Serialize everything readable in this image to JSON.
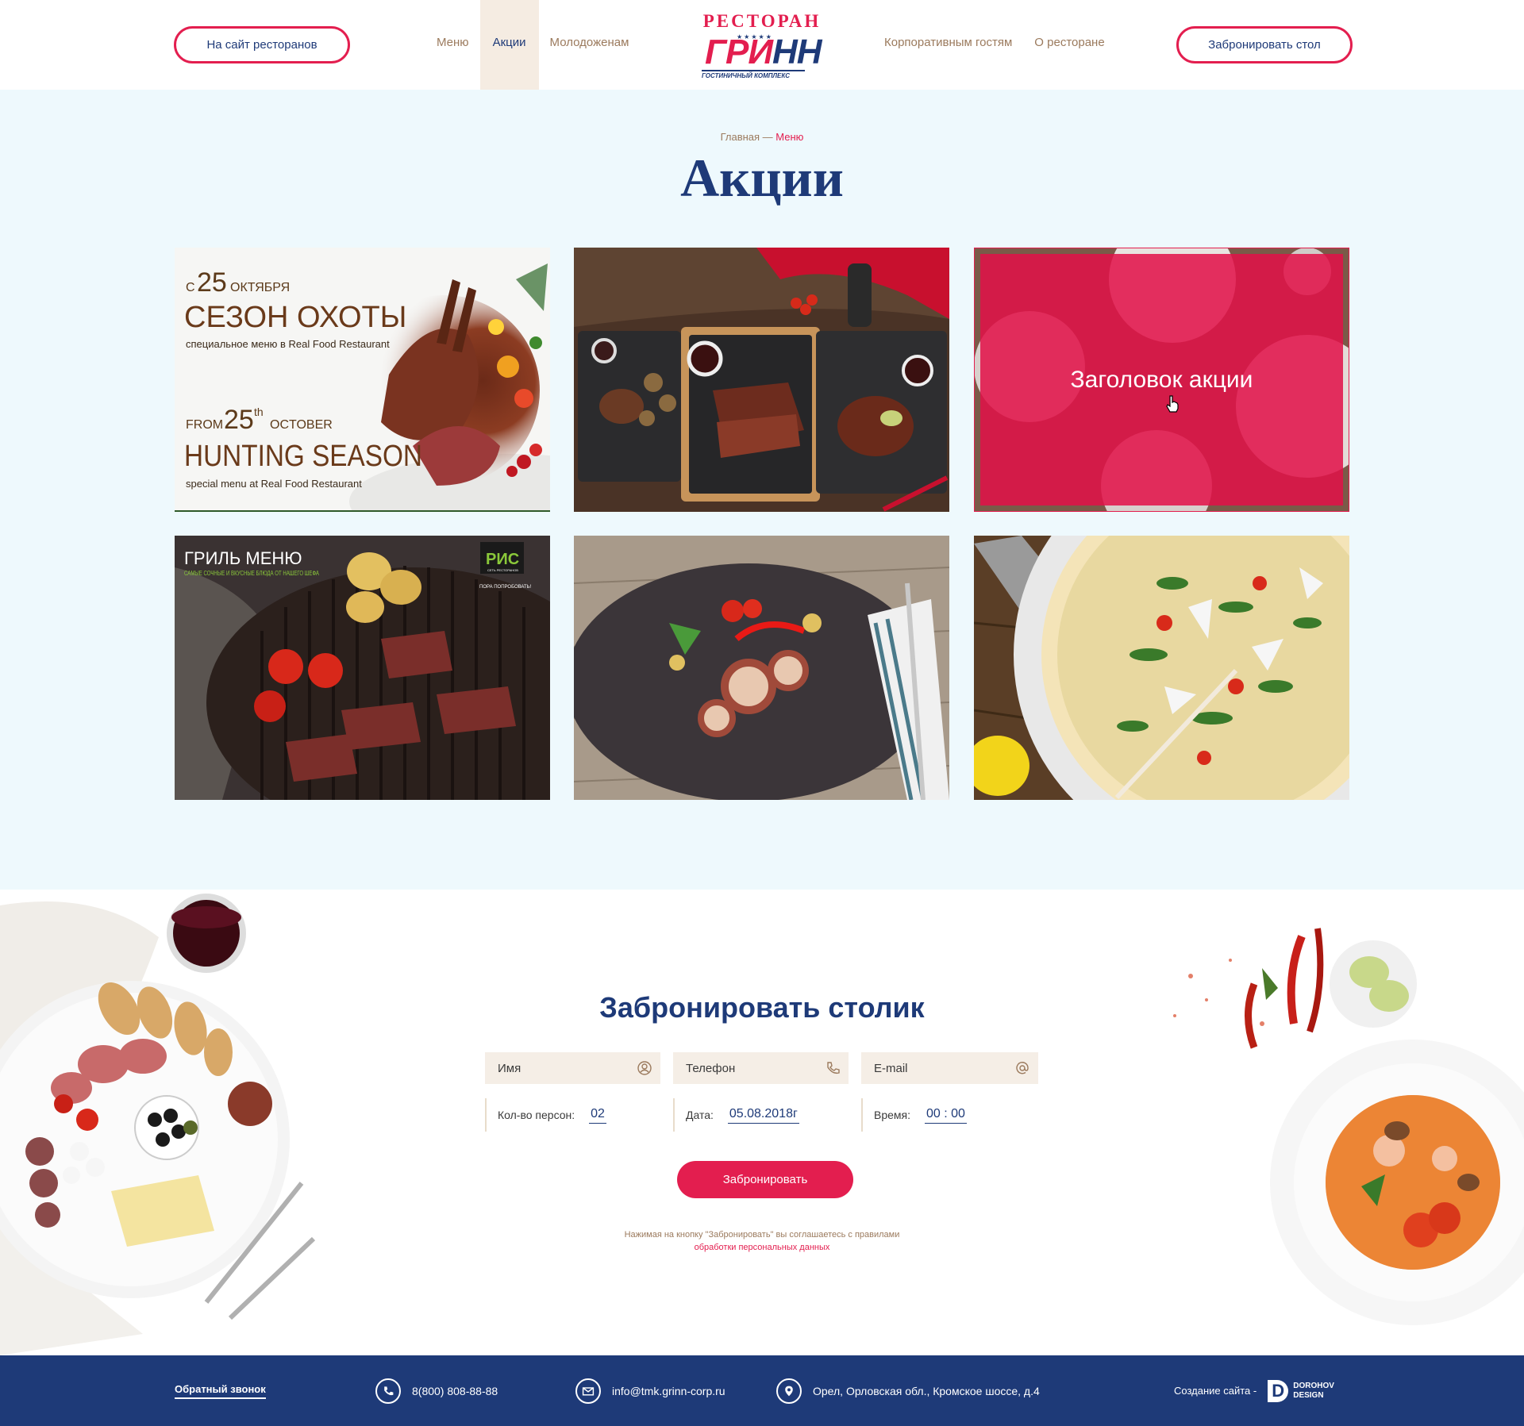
{
  "header": {
    "sites_button": "На сайт ресторанов",
    "book_button": "Забронировать стол",
    "nav_left": [
      "Меню",
      "Акции",
      "Молодоженам"
    ],
    "nav_right": [
      "Корпоративным гостям",
      "О ресторане"
    ],
    "active_nav": "Акции",
    "logo": {
      "top": "РЕСТОРАН",
      "stars": "★★★★★",
      "brand_red": "ГРИ",
      "brand_blue": "НН",
      "sub": "ГОСТИНИЧНЫЙ КОМПЛЕКС"
    }
  },
  "promo": {
    "breadcrumb": {
      "home": "Главная",
      "separator": " — ",
      "current": "Меню"
    },
    "title": "Акции",
    "cards": [
      {
        "image": "hunting-season-banner",
        "line1_prefix": "С",
        "line1_num": "25",
        "line1_suffix": "ОКТЯБРЯ",
        "headline_ru": "СЕЗОН ОХОТЫ",
        "sub_ru": "специальное меню в Real Food Restaurant",
        "line2_prefix": "FROM",
        "line2_num": "25",
        "line2_sup": "th",
        "line2_suffix": "OCTOBER",
        "headline_en": "HUNTING SEASON",
        "sub_en": "special menu at Real Food Restaurant"
      },
      {
        "image": "steaks-on-slate-boards"
      },
      {
        "image": "table-top-view",
        "hover_title": "Заголовок акции"
      },
      {
        "image": "grill-menu-steak",
        "headline": "ГРИЛЬ МЕНЮ",
        "sub": "САМЫЕ СОЧНЫЕ И ВКУСНЫЕ БЛЮДА ОТ НАШЕГО ШЕФА",
        "badge": "РИС",
        "badge_sub": "СЕТЬ РЕСТОРАНОВ",
        "badge_tag": "ПОРА ПОПРОБОВАТЬ!"
      },
      {
        "image": "grilled-octopus-plate"
      },
      {
        "image": "pizza-with-arugula"
      }
    ]
  },
  "booking": {
    "title": "Забронировать столик",
    "name_placeholder": "Имя",
    "phone_placeholder": "Телефон",
    "email_placeholder": "E-mail",
    "persons_label": "Кол-во персон:",
    "persons_value": "02",
    "date_label": "Дата:",
    "date_value": "05.08.2018г",
    "time_label": "Время:",
    "time_value": "00 : 00",
    "submit": "Забронировать",
    "consent_text": "Нажимая на кнопку \"Забронировать\" вы соглашаетесь с правилами",
    "consent_link": "обработки персональных данных"
  },
  "footer": {
    "callback": "Обратный звонок",
    "phone": "8(800) 808-88-88",
    "email": "info@tmk.grinn-corp.ru",
    "address": "Орел, Орловская обл., Кромское шоссе, д.4",
    "made_by": "Создание сайта -",
    "dev_logo_line1": "DOROHOV",
    "dev_logo_line2": "DESIGN"
  },
  "colors": {
    "brand_red": "#e31e4f",
    "brand_blue": "#1e3a78",
    "promo_bg": "#eef9fd",
    "field_bg": "#f5eee6",
    "muted_brown": "#9b7a5d"
  }
}
